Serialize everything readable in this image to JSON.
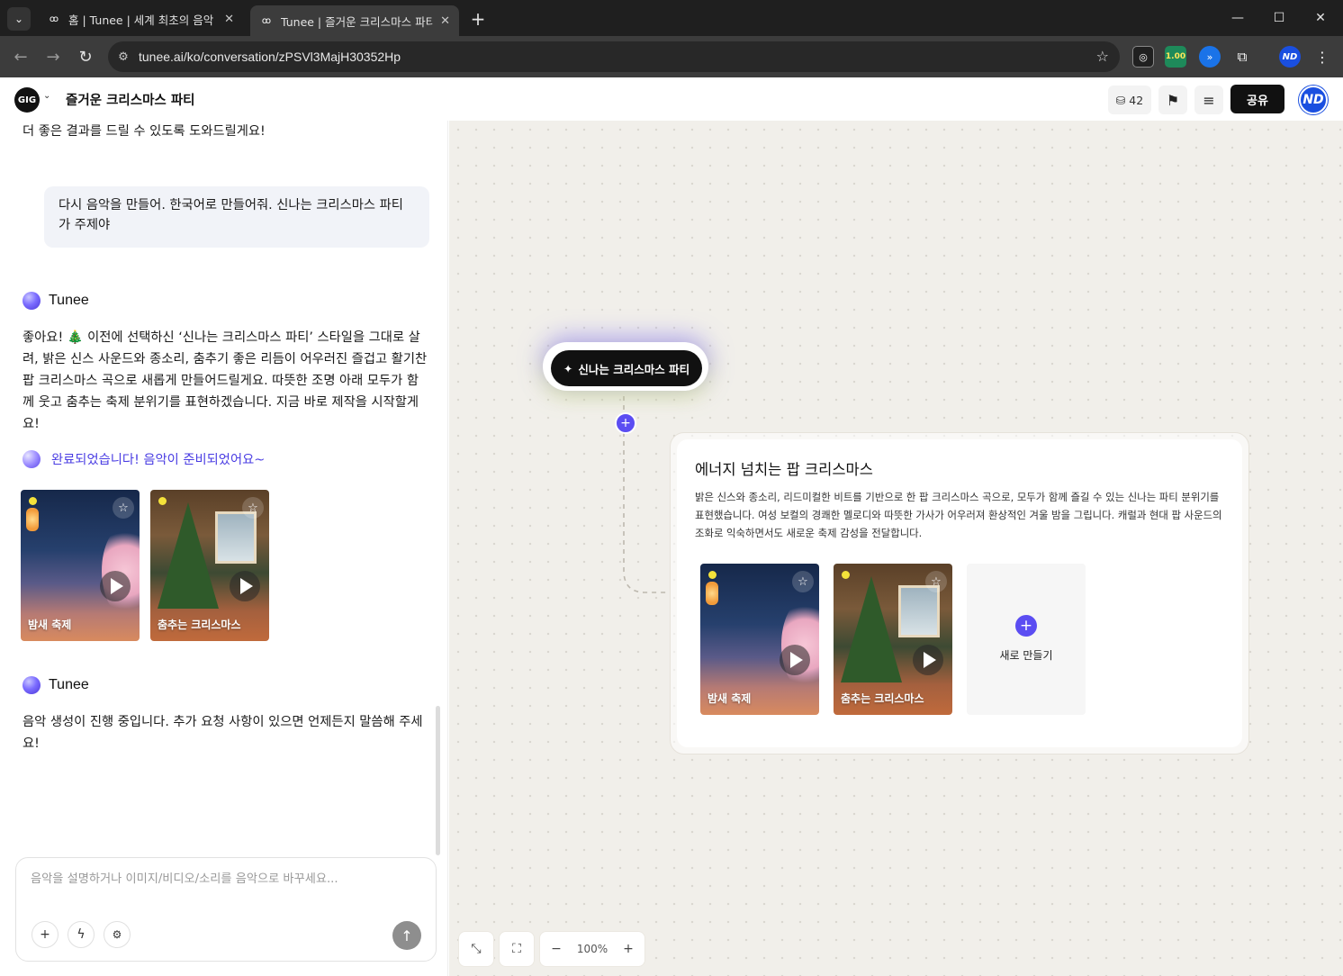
{
  "browser": {
    "tabs": [
      {
        "title": "홈 | Tunee | 세계 최초의 음악 에이전트",
        "active": false
      },
      {
        "title": "Tunee | 즐거운 크리스마스 파티",
        "active": true
      }
    ],
    "url": "tunee.ai/ko/conversation/zPSVl3MajH30352Hp",
    "extension_badge": "1.00",
    "profile_initials": "ND"
  },
  "header": {
    "logo_text": "GIG",
    "title": "즐거운 크리스마스 파티",
    "credits": "42",
    "share_label": "공유",
    "avatar_initials": "ND"
  },
  "chat": {
    "intro_text": "더 좋은 결과를 드릴 수 있도록 도와드릴게요!",
    "user_message": "다시 음악을 만들어. 한국어로 만들어줘. 신나는 크리스마스 파티가 주제야",
    "bot_name": "Tunee",
    "bot_reply": "좋아요! 🎄 이전에 선택하신 ‘신나는 크리스마스 파티’ 스타일을 그대로 살려, 밝은 신스 사운드와 종소리, 춤추기 좋은 리듬이 어우러진 즐겁고 활기찬 팝 크리스마스 곡으로 새롭게 만들어드릴게요. 따뜻한 조명 아래 모두가 함께 웃고 춤추는 축제 분위기를 표현하겠습니다. 지금 바로 제작을 시작할게요!",
    "done_text": "완료되었습니다! 음악이 준비되었어요~",
    "tracks": [
      {
        "title": "밤새 축제"
      },
      {
        "title": "춤추는 크리스마스"
      }
    ],
    "bot_name_2": "Tunee",
    "progress_text": "음악 생성이 진행 중입니다. 추가 요청 사항이 있으면 언제든지 말씀해 주세요!",
    "composer_placeholder": "음악을 설명하거나 이미지/비디오/소리를 음악으로 바꾸세요..."
  },
  "canvas": {
    "node_label": "신나는 크리스마스 파티",
    "card": {
      "title": "에너지 넘치는 팝 크리스마스",
      "description": "밝은 신스와 종소리, 리드미컬한 비트를 기반으로 한 팝 크리스마스 곡으로, 모두가 함께 즐길 수 있는 신나는 파티 분위기를 표현했습니다. 여성 보컬의 경쾌한 멜로디와 따뜻한 가사가 어우러져 환상적인 겨울 밤을 그립니다. 캐럴과 현대 팝 사운드의 조화로 익숙하면서도 새로운 축제 감성을 전달합니다.",
      "tracks": [
        {
          "title": "밤새 축제"
        },
        {
          "title": "춤추는 크리스마스"
        }
      ],
      "new_label": "새로 만들기"
    },
    "zoom_level": "100%"
  },
  "colors": {
    "accent": "#5b4df2",
    "canvas_bg": "#f1efea",
    "share_bg": "#111111",
    "avatar_bg": "#1a4fe0"
  }
}
